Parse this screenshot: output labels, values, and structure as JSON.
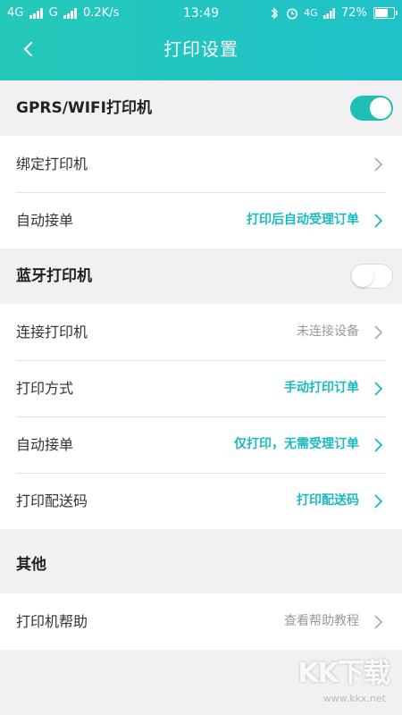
{
  "status_bar": {
    "left": "4G  G 0.2K/s",
    "net1": "4G",
    "net2": "G",
    "speed": "0.2K/s",
    "time": "13:49",
    "net_right": "4G",
    "battery": "72%"
  },
  "nav": {
    "title": "打印设置",
    "back_icon": "chevron-left-icon"
  },
  "sections": {
    "gprs": {
      "title": "GPRS/WIFI打印机",
      "toggle_on": true,
      "rows": [
        {
          "label": "绑定打印机",
          "value": ""
        },
        {
          "label": "自动接单",
          "value": "打印后自动受理订单"
        }
      ]
    },
    "bluetooth": {
      "title": "蓝牙打印机",
      "toggle_on": false,
      "rows": [
        {
          "label": "连接打印机",
          "value": "未连接设备"
        },
        {
          "label": "打印方式",
          "value": "手动打印订单"
        },
        {
          "label": "自动接单",
          "value": "仅打印，无需受理订单"
        },
        {
          "label": "打印配送码",
          "value": "打印配送码"
        }
      ]
    },
    "other": {
      "title": "其他",
      "rows": [
        {
          "label": "打印机帮助",
          "value": "查看帮助教程"
        }
      ]
    }
  },
  "watermark": {
    "logo": "KK下载",
    "url": "www.kkx.net"
  },
  "colors": {
    "accent": "#1bb9c3",
    "header_start": "#25c9b9",
    "header_end": "#1fc2c9",
    "toggle_on": "#1dbfb7",
    "muted": "#999999",
    "background": "#f1f1f1"
  }
}
